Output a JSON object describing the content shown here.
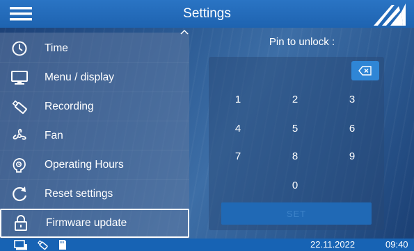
{
  "header": {
    "title": "Settings",
    "menu_icon": "hamburger-menu-icon",
    "logo_icon": "brand-logo-icon"
  },
  "menu": {
    "items": [
      {
        "label": "Time",
        "icon": "clock-icon"
      },
      {
        "label": "Menu / display",
        "icon": "monitor-icon"
      },
      {
        "label": "Recording",
        "icon": "usb-stick-icon"
      },
      {
        "label": "Fan",
        "icon": "fan-icon"
      },
      {
        "label": "Operating Hours",
        "icon": "hours-counter-icon"
      },
      {
        "label": "Reset settings",
        "icon": "reset-icon"
      },
      {
        "label": "Firmware update",
        "icon": "lock-icon",
        "selected": true
      }
    ],
    "scroll_icon": "chevron-up-icon"
  },
  "pin": {
    "label": "Pin to unlock :",
    "value": "",
    "backspace_icon": "backspace-icon",
    "keys": [
      "1",
      "2",
      "3",
      "4",
      "5",
      "6",
      "7",
      "8",
      "9",
      "0"
    ],
    "set_label": "SET"
  },
  "status": {
    "date": "22.11.2022",
    "time": "09:40",
    "icons": [
      "monitor-status-icon",
      "usb-status-icon",
      "sd-card-icon"
    ]
  },
  "colors": {
    "header": "#1e63b0",
    "statusbar": "#1763b4",
    "accent": "#2f86d6"
  }
}
